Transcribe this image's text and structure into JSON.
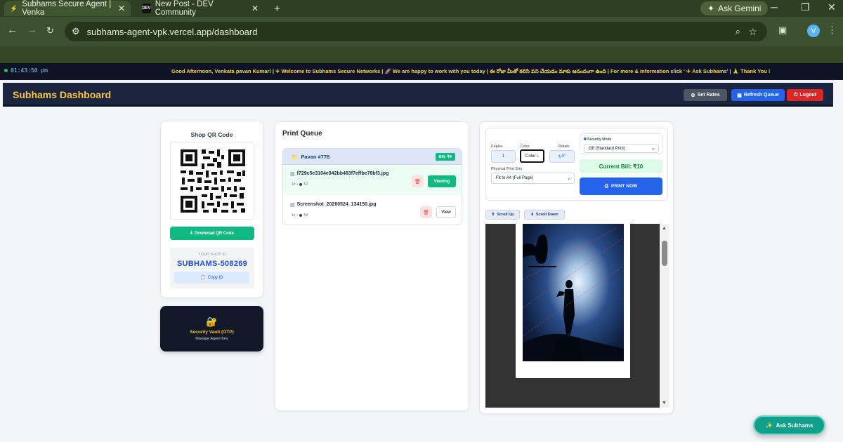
{
  "browser": {
    "tabs": [
      {
        "title": "Subhams Secure Agent | Venka",
        "favicon": "bolt-icon"
      },
      {
        "title": "New Post - DEV Community",
        "favicon": "DEV"
      }
    ],
    "new_tab": "+",
    "gemini_label": "Ask Gemini",
    "url": "subhams-agent-vpk.vercel.app/dashboard",
    "profile_initial": "V"
  },
  "ticker": {
    "clock": "01:43:50 pm",
    "message": "Good Afternoon, Venkata pavan Kumar! | ✈ Welcome to Subhams Secure Networks | 🚀 We are happy to work with you today | ఈ రోజు మీతో కలిసి పని చేయడం మాకు ఆనందంగా ఉంది | For more & information click ' ✈ Ask Subhams' | 🙏 Thank You !"
  },
  "header": {
    "title": "Subhams Dashboard",
    "set_rates": "Set Rates",
    "refresh_queue": "Refresh Queue",
    "logout": "Logout"
  },
  "qr_card": {
    "title": "Shop QR Code",
    "download_label": "Download QR Code",
    "shop_id_label": "YOUR SHOP ID",
    "shop_id": "SUBHAMS-508269",
    "copy_label": "Copy ID"
  },
  "vault": {
    "title": "Security Vault (OTP)",
    "subtitle": "Manage Agent Key"
  },
  "queue": {
    "title": "Print Queue",
    "job": {
      "name": "Pavan #778",
      "bill": "Bill: ₹4",
      "files": [
        {
          "name": "f729c5e3104e342bb483f7effbe78bf3.jpg",
          "meta_copies": "1x",
          "meta_price": "₹2",
          "action": "Viewing",
          "active": true
        },
        {
          "name": "Screenshot_20260524_134150.jpg",
          "meta_copies": "1x",
          "meta_price": "₹2",
          "action": "View",
          "active": false
        }
      ]
    }
  },
  "controls": {
    "copies_label": "Copies",
    "copies_value": "1",
    "color_label": "Color",
    "color_value": "Color",
    "rotate_label": "Rotate",
    "rotate_value": "0°",
    "physical_label": "Physical Print Size",
    "physical_value": "Fit to A4 (Full Page)",
    "security_label": "Security Mode",
    "security_value": "Off (Standard Print)",
    "current_bill": "Current Bill: ₹10",
    "print_now": "PRINT NOW",
    "scroll_up": "Scroll Up",
    "scroll_down": "Scroll Down"
  },
  "ask_button": "Ask Subhams",
  "colors": {
    "accent": "#2563eb",
    "success": "#10b981",
    "danger": "#dc2626",
    "header_bg": "#1b2540",
    "title_gold": "#f8c744"
  }
}
